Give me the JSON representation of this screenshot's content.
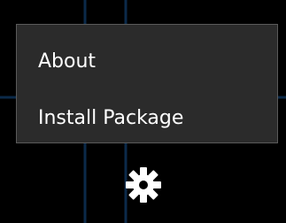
{
  "menu": {
    "items": [
      {
        "label": "About"
      },
      {
        "label": "Install Package"
      }
    ]
  },
  "settings_button": {
    "icon": "gear-icon"
  },
  "colors": {
    "background": "#000000",
    "menu_background": "#2b2b2b",
    "menu_border": "#5a5a5a",
    "text": "#ffffff",
    "grid_lines": "#0b2a4a"
  }
}
